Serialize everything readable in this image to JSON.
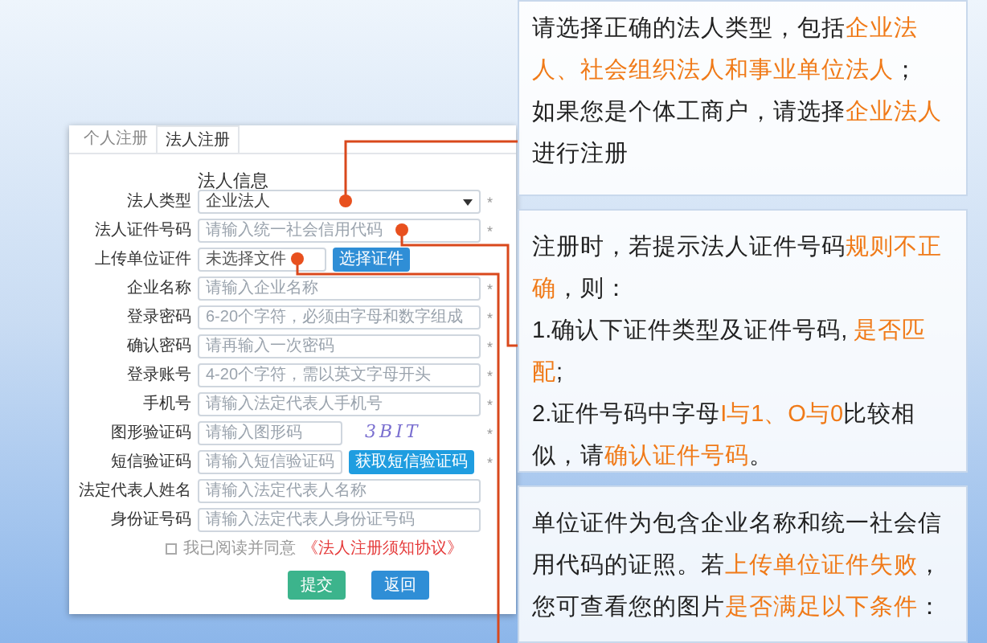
{
  "tabs": [
    {
      "label": "个人注册",
      "selected": false
    },
    {
      "label": "法人注册",
      "selected": true
    }
  ],
  "form": {
    "title": "法人信息",
    "fields": [
      {
        "kind": "select",
        "label": "法人类型",
        "value": "企业法人",
        "mark": "*"
      },
      {
        "kind": "text",
        "label": "法人证件号码",
        "placeholder": "请输入统一社会信用代码",
        "mark": "*"
      },
      {
        "kind": "file",
        "label": "上传单位证件",
        "value": "未选择文件",
        "button": "选择证件"
      },
      {
        "kind": "text",
        "label": "企业名称",
        "placeholder": "请输入企业名称",
        "mark": "*"
      },
      {
        "kind": "text",
        "label": "登录密码",
        "placeholder": "6-20个字符，必须由字母和数字组成",
        "mark": "*"
      },
      {
        "kind": "text",
        "label": "确认密码",
        "placeholder": "请再输入一次密码",
        "mark": "*"
      },
      {
        "kind": "text",
        "label": "登录账号",
        "placeholder": "4-20个字符，需以英文字母开头",
        "mark": "*"
      },
      {
        "kind": "text",
        "label": "手机号",
        "placeholder": "请输入法定代表人手机号",
        "mark": "*"
      },
      {
        "kind": "captcha",
        "label": "图形验证码",
        "placeholder": "请输入图形码",
        "captcha": "3BIT",
        "mark": "*"
      },
      {
        "kind": "sms",
        "label": "短信验证码",
        "placeholder": "请输入短信验证码",
        "button": "获取短信验证码",
        "mark": "*"
      },
      {
        "kind": "text",
        "label": "法定代表人姓名",
        "placeholder": "请输入法定代表人名称"
      },
      {
        "kind": "text",
        "label": "身份证号码",
        "placeholder": "请输入法定代表人身份证号码"
      }
    ],
    "agreement": {
      "checked": false,
      "text": "我已阅读并同意",
      "link": "《法人注册须知协议》"
    },
    "buttons": [
      {
        "label": "提交",
        "kind": "submit"
      },
      {
        "label": "返回",
        "kind": "back"
      }
    ]
  },
  "callouts": [
    {
      "paragraphs": [
        {
          "segments": [
            {
              "text": "请选择正确的法人类型，包括",
              "highlight": false
            },
            {
              "text": "企业法人、社会组织法人和事业单位法人",
              "highlight": true
            },
            {
              "text": "；",
              "highlight": false
            }
          ]
        },
        {
          "segments": [
            {
              "text": "如果您是个体工商户，请选择",
              "highlight": false
            },
            {
              "text": "企业法人",
              "highlight": true
            },
            {
              "text": "进行注册",
              "highlight": false
            }
          ]
        }
      ]
    },
    {
      "paragraphs": [
        {
          "segments": [
            {
              "text": "注册时，若提示法人证件号码",
              "highlight": false
            },
            {
              "text": "规则不正确",
              "highlight": true
            },
            {
              "text": "，则：",
              "highlight": false
            }
          ]
        },
        {
          "segments": [
            {
              "text": "1.确认下证件类型及证件号码, ",
              "highlight": false
            },
            {
              "text": "是否匹配",
              "highlight": true
            },
            {
              "text": ";",
              "highlight": false
            }
          ]
        },
        {
          "segments": [
            {
              "text": "2.证件号码中字母",
              "highlight": false
            },
            {
              "text": "I与1、O与0",
              "highlight": true
            },
            {
              "text": "比较相似，请",
              "highlight": false
            },
            {
              "text": "确认证件号码",
              "highlight": true
            },
            {
              "text": "。",
              "highlight": false
            }
          ]
        }
      ]
    },
    {
      "paragraphs": [
        {
          "segments": [
            {
              "text": "单位证件为包含企业名称和统一社会信用代码的证照。若",
              "highlight": false
            },
            {
              "text": "上传单位证件失败",
              "highlight": true
            },
            {
              "text": "，您可查看您的图片",
              "highlight": false
            },
            {
              "text": "是否满足以下条件",
              "highlight": true
            },
            {
              "text": "：",
              "highlight": false
            }
          ]
        }
      ]
    }
  ]
}
